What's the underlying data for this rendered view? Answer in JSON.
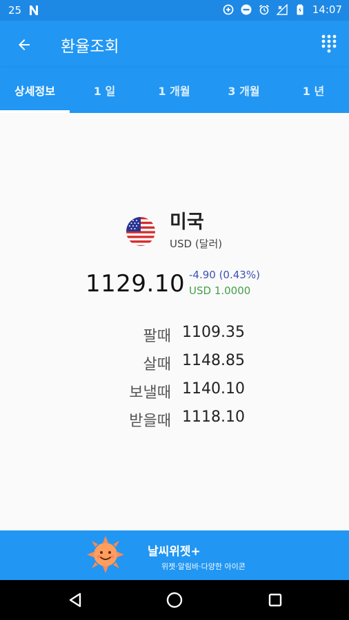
{
  "status_bar": {
    "left_text": "25",
    "time": "14:07",
    "icons": [
      "notification-n-icon",
      "data-saver-icon",
      "do-not-disturb-icon",
      "alarm-icon",
      "no-signal-icon",
      "battery-icon"
    ]
  },
  "app_bar": {
    "title": "환율조회",
    "back_icon": "arrow-left-icon",
    "menu_icon": "dialpad-grid-icon"
  },
  "tabs": [
    {
      "label": "상세정보",
      "selected": true
    },
    {
      "label": "1 일",
      "selected": false
    },
    {
      "label": "1 개월",
      "selected": false
    },
    {
      "label": "3 개월",
      "selected": false
    },
    {
      "label": "1 년",
      "selected": false
    }
  ],
  "detail": {
    "country": "미국",
    "currency": "USD (달러)",
    "flag_icon": "us-flag-icon",
    "rate": "1129.10",
    "change": "-4.90 (0.43%)",
    "base": "USD 1.0000",
    "rows": [
      {
        "label": "팔때",
        "value": "1109.35"
      },
      {
        "label": "살때",
        "value": "1148.85"
      },
      {
        "label": "보낼때",
        "value": "1140.10"
      },
      {
        "label": "받을때",
        "value": "1118.10"
      }
    ]
  },
  "ad": {
    "title": "날씨위젯+",
    "subtitle": "위젯·알림바·다양한 아이콘",
    "icon": "smiling-sun-icon"
  },
  "colors": {
    "status_bar": "#1e88e5",
    "primary": "#2196f3",
    "change_text": "#3f51b5",
    "base_text": "#43a047"
  },
  "nav_bar": {
    "icons": [
      "back-triangle-icon",
      "home-circle-icon",
      "recents-square-icon"
    ]
  }
}
